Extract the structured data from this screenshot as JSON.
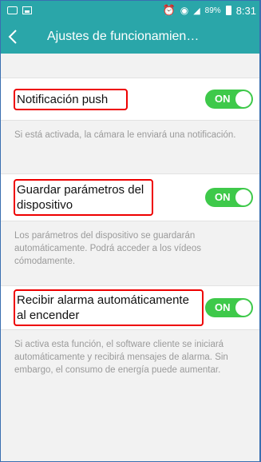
{
  "status_bar": {
    "battery_percent": "89%",
    "time": "8:31"
  },
  "header": {
    "title": "Ajustes de funcionamien…"
  },
  "settings": [
    {
      "label": "Notificación push",
      "toggle": "ON",
      "description": "Si está activada, la cámara le enviará una notificación."
    },
    {
      "label": "Guardar parámetros del dispositivo",
      "toggle": "ON",
      "description": "Los parámetros del dispositivo se guardarán automáticamente. Podrá acceder a los vídeos cómodamente."
    },
    {
      "label": "Recibir alarma automáticamente al encender",
      "toggle": "ON",
      "description": "Si activa esta función, el software cliente se iniciará automáticamente y recibirá mensajes de alarma. Sin embargo, el consumo de energía puede aumentar."
    }
  ],
  "colors": {
    "accent": "#2aa6a9",
    "toggle_on": "#3ec94a",
    "highlight": "#e00000"
  }
}
